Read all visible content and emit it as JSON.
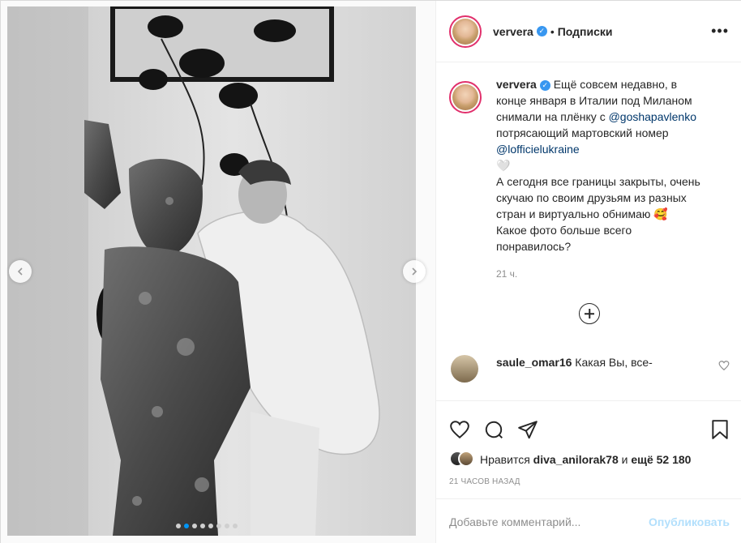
{
  "post": {
    "username": "ververa",
    "separator": "•",
    "follow_label": "Подписки",
    "more_label": "•••",
    "verified_glyph": "✓"
  },
  "caption": {
    "username": "ververa",
    "text_part1": " Ещё совсем недавно, в конце января в Италии под Миланом снимали на плёнку с ",
    "mention1": "@goshapavlenko",
    "text_part2": " потрясающий мартовский номер ",
    "mention2": "@lofficielukraine",
    "text_part3": "\n🤍\nА сегодня все границы закрыты, очень скучаю по своим друзьям из разных стран и виртуально обнимаю 🥰\nКакое фото больше всего понравилось?",
    "time": "21 ч."
  },
  "comment": {
    "username": "saule_omar16",
    "text": " Какая Вы, все-"
  },
  "carousel": {
    "slide_count": 8,
    "active_index": 1
  },
  "likes": {
    "prefix": "Нравится ",
    "user": "diva_anilorak78",
    "middle": " и ",
    "rest": "ещё 52 180"
  },
  "timestamp": "21 ЧАСОВ НАЗАД",
  "comment_input": {
    "placeholder": "Добавьте комментарий...",
    "post_label": "Опубликовать"
  },
  "icons": {
    "like": "heart-icon",
    "comment": "comment-icon",
    "share": "share-icon",
    "save": "bookmark-icon",
    "add": "plus-circle-icon"
  }
}
